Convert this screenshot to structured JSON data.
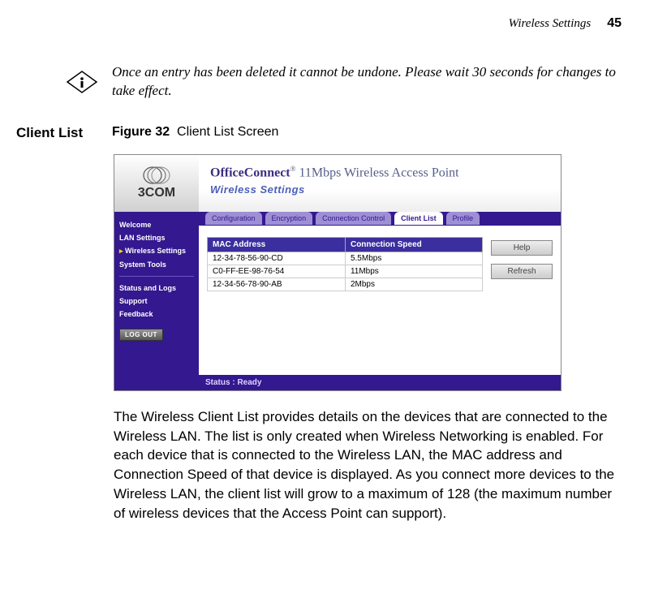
{
  "header": {
    "section": "Wireless Settings",
    "page_number": "45"
  },
  "note": {
    "text": "Once an entry has been deleted it cannot be undone. Please wait 30 seconds for changes to take effect."
  },
  "section": {
    "label": "Client List",
    "figure_number": "Figure 32",
    "figure_caption": "Client List Screen"
  },
  "screenshot": {
    "logo_text": "3COM",
    "brand_prefix": "OfficeConnect",
    "brand_suffix": " 11Mbps Wireless Access Point",
    "brand_sub": "Wireless Settings",
    "sidebar": {
      "items": [
        {
          "label": "Welcome",
          "active": false
        },
        {
          "label": "LAN Settings",
          "active": false
        },
        {
          "label": "Wireless Settings",
          "active": true
        },
        {
          "label": "System Tools",
          "active": false
        }
      ],
      "items2": [
        {
          "label": "Status and Logs"
        },
        {
          "label": "Support"
        },
        {
          "label": "Feedback"
        }
      ],
      "logout": "LOG OUT"
    },
    "tabs": [
      {
        "label": "Configuration",
        "active": false
      },
      {
        "label": "Encryption",
        "active": false
      },
      {
        "label": "Connection Control",
        "active": false
      },
      {
        "label": "Client List",
        "active": true
      },
      {
        "label": "Profile",
        "active": false
      }
    ],
    "table": {
      "headers": [
        "MAC Address",
        "Connection Speed"
      ],
      "rows": [
        [
          "12-34-78-56-90-CD",
          "5.5Mbps"
        ],
        [
          "C0-FF-EE-98-76-54",
          "11Mbps"
        ],
        [
          "12-34-56-78-90-AB",
          "2Mbps"
        ]
      ]
    },
    "buttons": {
      "help": "Help",
      "refresh": "Refresh"
    },
    "status": "Status : Ready"
  },
  "body_text": "The Wireless Client List provides details on the devices that are connected to the Wireless LAN. The list is only created when Wireless Networking is enabled. For each device that is connected to the Wireless LAN, the MAC address and Connection Speed of that device is displayed. As you connect more devices to the Wireless LAN, the client list will grow to a maximum of 128 (the maximum number of wireless devices that the Access Point can support)."
}
